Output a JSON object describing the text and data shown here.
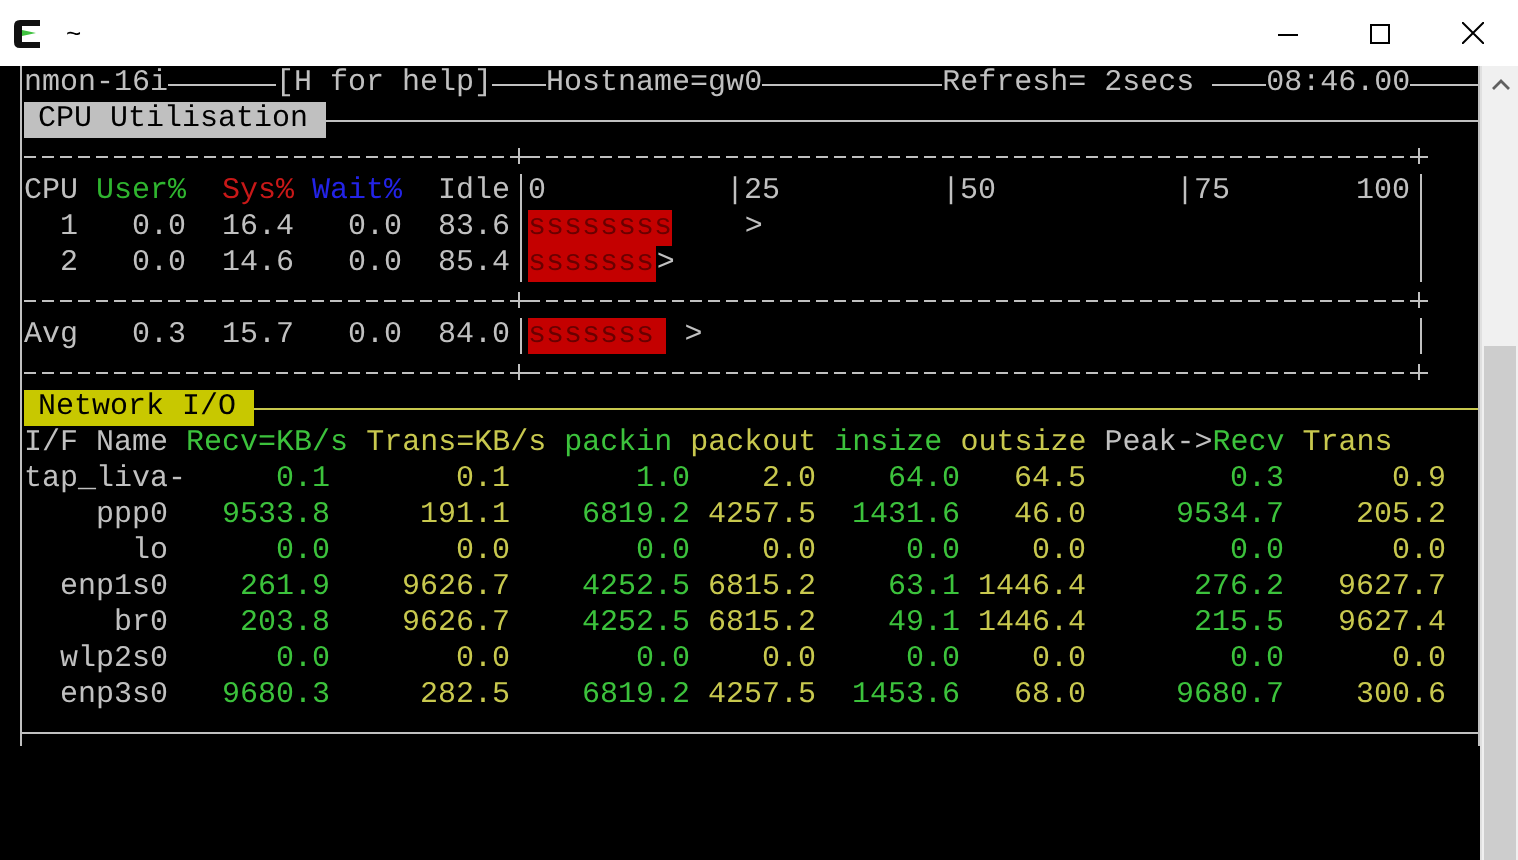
{
  "window": {
    "title": "~"
  },
  "header": {
    "program": "nmon-16i",
    "help": "[H for help]",
    "hostname": "Hostname=gw0",
    "refresh": "Refresh= 2secs",
    "time": "08:46.00"
  },
  "cpu": {
    "title": "CPU Utilisation",
    "columns": [
      {
        "label": "CPU",
        "color": "#c0c0c0"
      },
      {
        "label": "User%",
        "color": "#2fb52f"
      },
      {
        "label": "Sys%",
        "color": "#c81818"
      },
      {
        "label": "Wait%",
        "color": "#2323e6"
      },
      {
        "label": "Idle",
        "color": "#c0c0c0"
      }
    ],
    "scale": [
      "0",
      "|25",
      "|50",
      "|75",
      "100"
    ],
    "rows": [
      {
        "cpu": "1",
        "user": "0.0",
        "sys": "16.4",
        "wait": "0.0",
        "idle": "83.6",
        "bar": "ssssssss",
        "level": 0.164,
        "peak": "    >"
      },
      {
        "cpu": "2",
        "user": "0.0",
        "sys": "14.6",
        "wait": "0.0",
        "idle": "85.4",
        "bar": "sssssss",
        "level": 0.146,
        "peak": ">"
      }
    ],
    "average": {
      "cpu": "Avg",
      "user": "0.3",
      "sys": "15.7",
      "wait": "0.0",
      "idle": "84.0",
      "bar": "sssssss",
      "level": 0.157,
      "peak": " >"
    }
  },
  "network": {
    "title": "Network I/O",
    "columns": [
      {
        "label": "I/F Name",
        "color": "#c0c0c0"
      },
      {
        "label": "Recv=KB/s",
        "color": "#3cc23c"
      },
      {
        "label": "Trans=KB/s",
        "color": "#c8c84e"
      },
      {
        "label": "packin",
        "color": "#3cc23c"
      },
      {
        "label": "packout",
        "color": "#c8c84e"
      },
      {
        "label": "insize",
        "color": "#3cc23c"
      },
      {
        "label": "outsize",
        "color": "#c8c84e"
      },
      {
        "label": "Recv",
        "prefix": "Peak->",
        "color": "#3cc23c"
      },
      {
        "label": "Trans",
        "color": "#c8c84e"
      }
    ],
    "rows": [
      {
        "name": "tap_liva-",
        "values": [
          "0.1",
          "0.1",
          "1.0",
          "2.0",
          "64.0",
          "64.5",
          "0.3",
          "0.9"
        ]
      },
      {
        "name": "ppp0",
        "values": [
          "9533.8",
          "191.1",
          "6819.2",
          "4257.5",
          "1431.6",
          "46.0",
          "9534.7",
          "205.2"
        ]
      },
      {
        "name": "lo",
        "values": [
          "0.0",
          "0.0",
          "0.0",
          "0.0",
          "0.0",
          "0.0",
          "0.0",
          "0.0"
        ]
      },
      {
        "name": "enp1s0",
        "values": [
          "261.9",
          "9626.7",
          "4252.5",
          "6815.2",
          "63.1",
          "1446.4",
          "276.2",
          "9627.7"
        ]
      },
      {
        "name": "br0",
        "values": [
          "203.8",
          "9626.7",
          "4252.5",
          "6815.2",
          "49.1",
          "1446.4",
          "215.5",
          "9627.4"
        ]
      },
      {
        "name": "wlp2s0",
        "values": [
          "0.0",
          "0.0",
          "0.0",
          "0.0",
          "0.0",
          "0.0",
          "0.0",
          "0.0"
        ]
      },
      {
        "name": "enp3s0",
        "values": [
          "9680.3",
          "282.5",
          "6819.2",
          "4257.5",
          "1453.6",
          "68.0",
          "9680.7",
          "300.6"
        ]
      }
    ]
  }
}
